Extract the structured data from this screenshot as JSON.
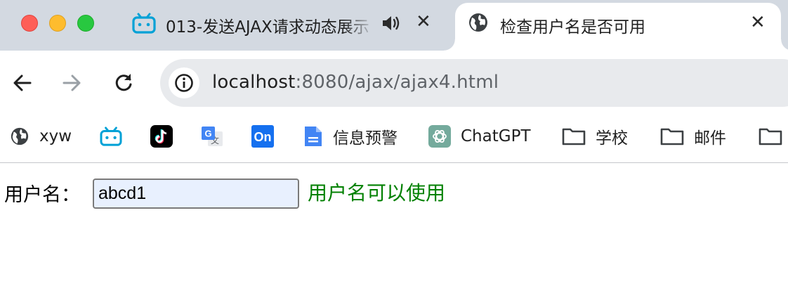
{
  "window": {
    "controls": [
      "close",
      "minimize",
      "maximize"
    ]
  },
  "tabs": [
    {
      "title": "013-发送AJAX请求动态展示",
      "favicon": "bilibili-icon",
      "audio": "speaker-icon",
      "close": "✕",
      "active": false
    },
    {
      "title": "检查用户名是否可用",
      "favicon": "globe-icon",
      "close": "✕",
      "active": true
    }
  ],
  "toolbar": {
    "back": "arrow-left-icon",
    "forward": "arrow-right-icon",
    "reload": "reload-icon",
    "site_info": "info-icon",
    "url_host": "localhost",
    "url_rest": ":8080/ajax/ajax4.html"
  },
  "bookmarks": [
    {
      "label": "xyw",
      "icon": "globe-icon"
    },
    {
      "label": "",
      "icon": "bilibili-icon"
    },
    {
      "label": "",
      "icon": "tiktok-icon"
    },
    {
      "label": "",
      "icon": "google-translate-icon"
    },
    {
      "label": "",
      "icon": "onshape-icon",
      "icon_text": "On"
    },
    {
      "label": "信息预警",
      "icon": "google-docs-icon"
    },
    {
      "label": "ChatGPT",
      "icon": "chatgpt-icon"
    },
    {
      "label": "学校",
      "icon": "folder-icon"
    },
    {
      "label": "邮件",
      "icon": "folder-icon"
    },
    {
      "label": "",
      "icon": "folder-icon"
    }
  ],
  "page": {
    "username_label": "用户名：",
    "username_value": "abcd1",
    "status_message": "用户名可以使用",
    "status_color": "#008000"
  },
  "colors": {
    "tabstrip": "#d3d9e1",
    "omnibox": "#e8eaed",
    "input_fill": "#e8f0fe"
  }
}
